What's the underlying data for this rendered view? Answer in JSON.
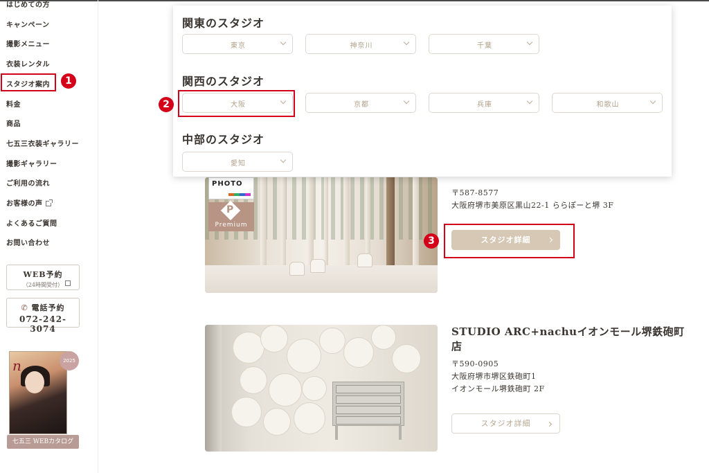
{
  "sidebar": {
    "nav": [
      {
        "label": "はじめての方"
      },
      {
        "label": "キャンペーン"
      },
      {
        "label": "撮影メニュー"
      },
      {
        "label": "衣装レンタル"
      },
      {
        "label": "スタジオ案内"
      },
      {
        "label": "料金"
      },
      {
        "label": "商品"
      },
      {
        "label": "七五三衣装ギャラリー"
      },
      {
        "label": "撮影ギャラリー"
      },
      {
        "label": "ご利用の流れ"
      },
      {
        "label": "お客様の声"
      },
      {
        "label": "よくあるご質問"
      },
      {
        "label": "お問い合わせ"
      }
    ],
    "web_reserve": {
      "label": "WEB予約",
      "sub": "（24時間受付）"
    },
    "phone_reserve": {
      "label": "電話予約",
      "number": "072-242-3074"
    },
    "catalog": {
      "label": "七五三 WEBカタログ",
      "logo": "n",
      "seal": "2025"
    }
  },
  "annotations": [
    "1",
    "2",
    "3"
  ],
  "regions": {
    "kanto": {
      "title": "関東のスタジオ",
      "options": [
        "東京",
        "神奈川",
        "千葉"
      ]
    },
    "kansai": {
      "title": "関西のスタジオ",
      "options": [
        "大阪",
        "京都",
        "兵庫",
        "和歌山"
      ]
    },
    "chubu": {
      "title": "中部のスタジオ",
      "options": [
        "愛知"
      ]
    }
  },
  "studios": [
    {
      "postal": "〒587-8577",
      "address": "大阪府堺市美原区黒山22-1 ららぽーと堺 3F",
      "detail_label": "スタジオ詳細",
      "badge_text": "PHOTO",
      "premium_text": "Premium",
      "premium_letter": "P"
    },
    {
      "name": "STUDIO ARC+nachuイオンモール堺鉄砲町店",
      "postal": "〒590-0905",
      "address1": "大阪府堺市堺区鉄砲町1",
      "address2": "イオンモール堺鉄砲町 2F",
      "detail_label": "スタジオ詳細"
    }
  ],
  "colors": {
    "highlight": "#d4001a",
    "accent": "#d7c8b6"
  }
}
